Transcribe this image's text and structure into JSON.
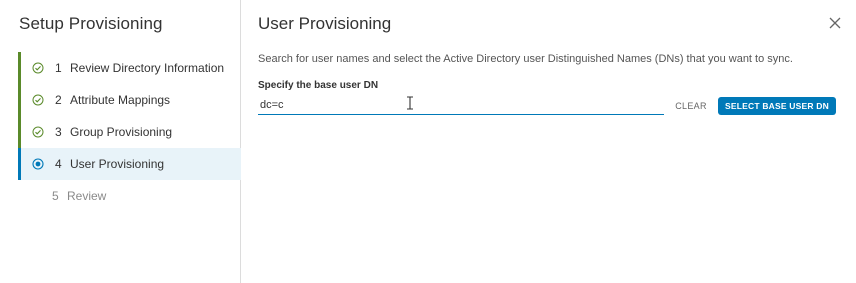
{
  "sidebar": {
    "title": "Setup Provisioning",
    "steps": [
      {
        "num": "1",
        "label": "Review Directory Information",
        "state": "done"
      },
      {
        "num": "2",
        "label": "Attribute Mappings",
        "state": "done"
      },
      {
        "num": "3",
        "label": "Group Provisioning",
        "state": "done"
      },
      {
        "num": "4",
        "label": "User Provisioning",
        "state": "active"
      },
      {
        "num": "5",
        "label": "Review",
        "state": "pending"
      }
    ]
  },
  "main": {
    "title": "User Provisioning",
    "description": "Search for user names and select the Active Directory user Distinguished Names (DNs) that you want to sync.",
    "field_label": "Specify the base user DN",
    "input_value": "dc=c",
    "clear_label": "CLEAR",
    "select_label": "SELECT BASE USER DN"
  },
  "colors": {
    "accent": "#0079b8",
    "done": "#5a8a2a",
    "active_bg": "#e8f3f9"
  },
  "icons": {
    "done_step": "check-circle-icon",
    "active_step": "dot-circle-icon",
    "close": "close-icon",
    "cursor": "text-cursor-icon"
  }
}
